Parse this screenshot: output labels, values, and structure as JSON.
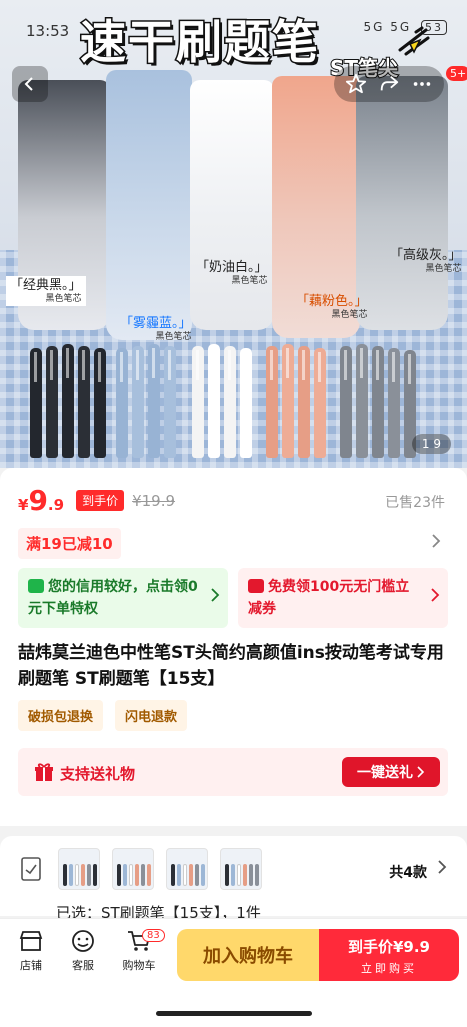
{
  "status_bar": {
    "time": "13:53",
    "signal_icons": "5G 5G",
    "battery": "53"
  },
  "hero": {
    "title": "速干刷题笔",
    "subtitle": "ST笔尖",
    "image_counter": "1 9",
    "nav_badge": "5+",
    "labels": [
      {
        "main": "「经典黑。」",
        "sub": "黑色笔芯"
      },
      {
        "main": "「雾霾蓝。」",
        "sub": "黑色笔芯"
      },
      {
        "main": "「奶油白。」",
        "sub": "黑色笔芯"
      },
      {
        "main": "「藕粉色。」",
        "sub": "黑色笔芯"
      },
      {
        "main": "「高级灰。」",
        "sub": "黑色笔芯"
      }
    ],
    "pen_colors": [
      "#2b2f36",
      "#9db7d6",
      "#f4f4f4",
      "#e69e86",
      "#8a9099"
    ]
  },
  "price": {
    "currency": "¥",
    "integer": "9",
    "decimal": ".9",
    "to_hand_label": "到手价",
    "original": "¥19.9",
    "sold": "已售23件"
  },
  "promo": {
    "text": "满19已减10"
  },
  "benefits": {
    "credit": "您的信用较好，点击领0元下单特权",
    "coupon": "免费领100元无门槛立减券"
  },
  "product": {
    "title": "喆炜莫兰迪色中性笔ST头简约高颜值ins按动笔考试专用刷题笔 ST刷题笔【15支】",
    "tags": [
      "破损包退换",
      "闪电退款"
    ]
  },
  "gift": {
    "text": "支持送礼物",
    "button": "一键送礼"
  },
  "variants": {
    "count_label": "共4款",
    "selected": "已选：ST刷题笔【15支】，1件"
  },
  "bottom_bar": {
    "shop": "店铺",
    "service": "客服",
    "cart": "购物车",
    "cart_count": "83",
    "add_to_cart": "加入购物车",
    "buy_price": "到手价¥9.9",
    "buy_now": "立即购买"
  },
  "colors": {
    "accent_red": "#ff2b2b",
    "cart_yellow": "#ffd86b",
    "buy_red": "#ff2a3a"
  }
}
